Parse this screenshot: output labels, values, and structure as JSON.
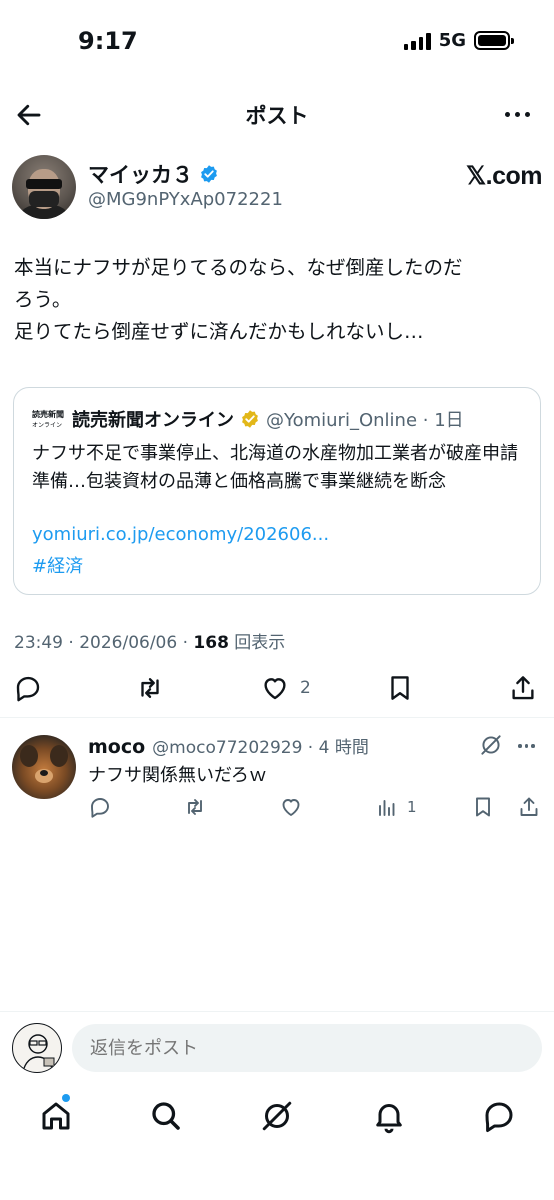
{
  "status_bar": {
    "time": "9:17",
    "network": "5G"
  },
  "header": {
    "title": "ポスト"
  },
  "author": {
    "name": "マイッカ３",
    "handle": "@MG9nPYxAp072221",
    "watermark": "𝕏.com"
  },
  "post": {
    "text": "本当にナフサが足りてるのなら、なぜ倒産したのだ\nろう。\n足りてたら倒産せずに済んだかもしれないし…"
  },
  "quote": {
    "logo_line1": "読売新聞",
    "logo_line2": "オンライン",
    "name": "読売新聞オンライン",
    "handle_time": "@Yomiuri_Online · 1日",
    "body": "ナフサ不足で事業停止、北海道の水産物加工業者が破産申請準備…包装資材の品薄と価格高騰で事業継続を断念",
    "link": "yomiuri.co.jp/economy/202606...",
    "hashtag": "#経済"
  },
  "meta": {
    "time_date": "23:49 · 2026/06/06 · ",
    "views": "168",
    "views_label": " 回表示"
  },
  "actions": {
    "like_count": "2"
  },
  "reply": {
    "name": "moco",
    "handle_time": "@moco77202929 · 4 時間",
    "text": "ナフサ関係無いだろｗ",
    "views_count": "1"
  },
  "compose": {
    "placeholder": "返信をポスト"
  },
  "colors": {
    "accent": "#1d9bf0",
    "secondary_text": "#536471",
    "verified_blue": "#1d9bf0",
    "verified_gold": "#e2b719"
  }
}
